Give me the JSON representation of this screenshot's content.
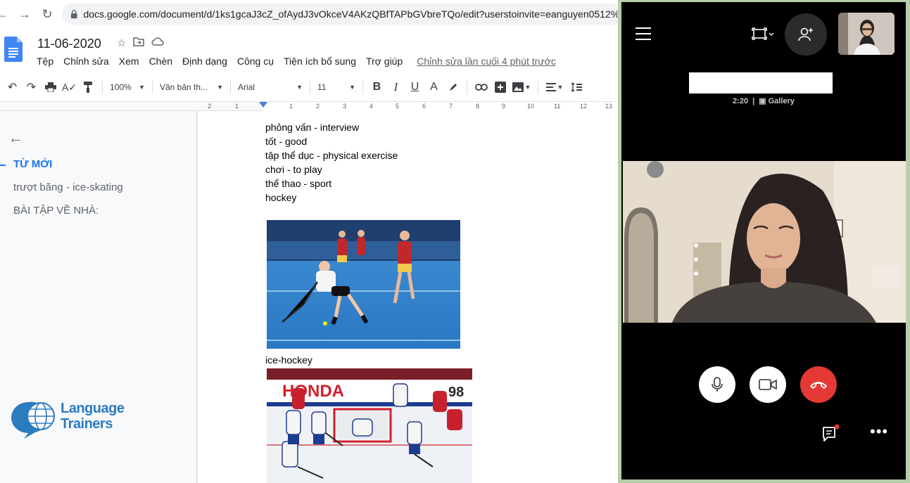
{
  "browser": {
    "url": "docs.google.com/document/d/1ks1gcaJ3cZ_ofAydJ3vOkceV4AKzQBfTAPbGVbreTQo/edit?userstoinvite=eanguyen0512%4"
  },
  "docs": {
    "title": "11-06-2020",
    "menu": [
      "Tệp",
      "Chỉnh sửa",
      "Xem",
      "Chèn",
      "Định dạng",
      "Công cụ",
      "Tiện ích bổ sung",
      "Trợ giúp"
    ],
    "last_edit": "Chỉnh sửa lần cuối 4 phút trước",
    "toolbar": {
      "zoom": "100%",
      "style": "Văn bản th...",
      "font": "Arial",
      "size": "11"
    },
    "ruler_numbers": [
      "2",
      "1",
      "1",
      "2",
      "3",
      "4",
      "5",
      "6",
      "7",
      "8",
      "9",
      "10",
      "11",
      "12",
      "13"
    ]
  },
  "outline": {
    "items": [
      {
        "label": "TỪ MỚI",
        "active": true
      },
      {
        "label": "trượt băng - ice-skating",
        "active": false
      },
      {
        "label": "BÀI TẬP VỀ NHÀ:",
        "active": false
      }
    ],
    "logo": {
      "line1": "Language",
      "line2": "Trainers"
    }
  },
  "document": {
    "lines": [
      "phỏng vấn - interview",
      "tốt - good",
      "tập thể dục - physical exercise",
      "chơi - to play",
      "thể thao - sport",
      "hockey"
    ],
    "caption": "ice-hockey",
    "hockey_board_text": "HONDA",
    "jersey_number": "98"
  },
  "call": {
    "duration": "2:20",
    "view": "Gallery"
  },
  "colors": {
    "docs_blue": "#1a73e8",
    "end_call_red": "#e53935",
    "call_frame_green": "#b7cfa9",
    "logo_blue": "#2b7bbf"
  }
}
